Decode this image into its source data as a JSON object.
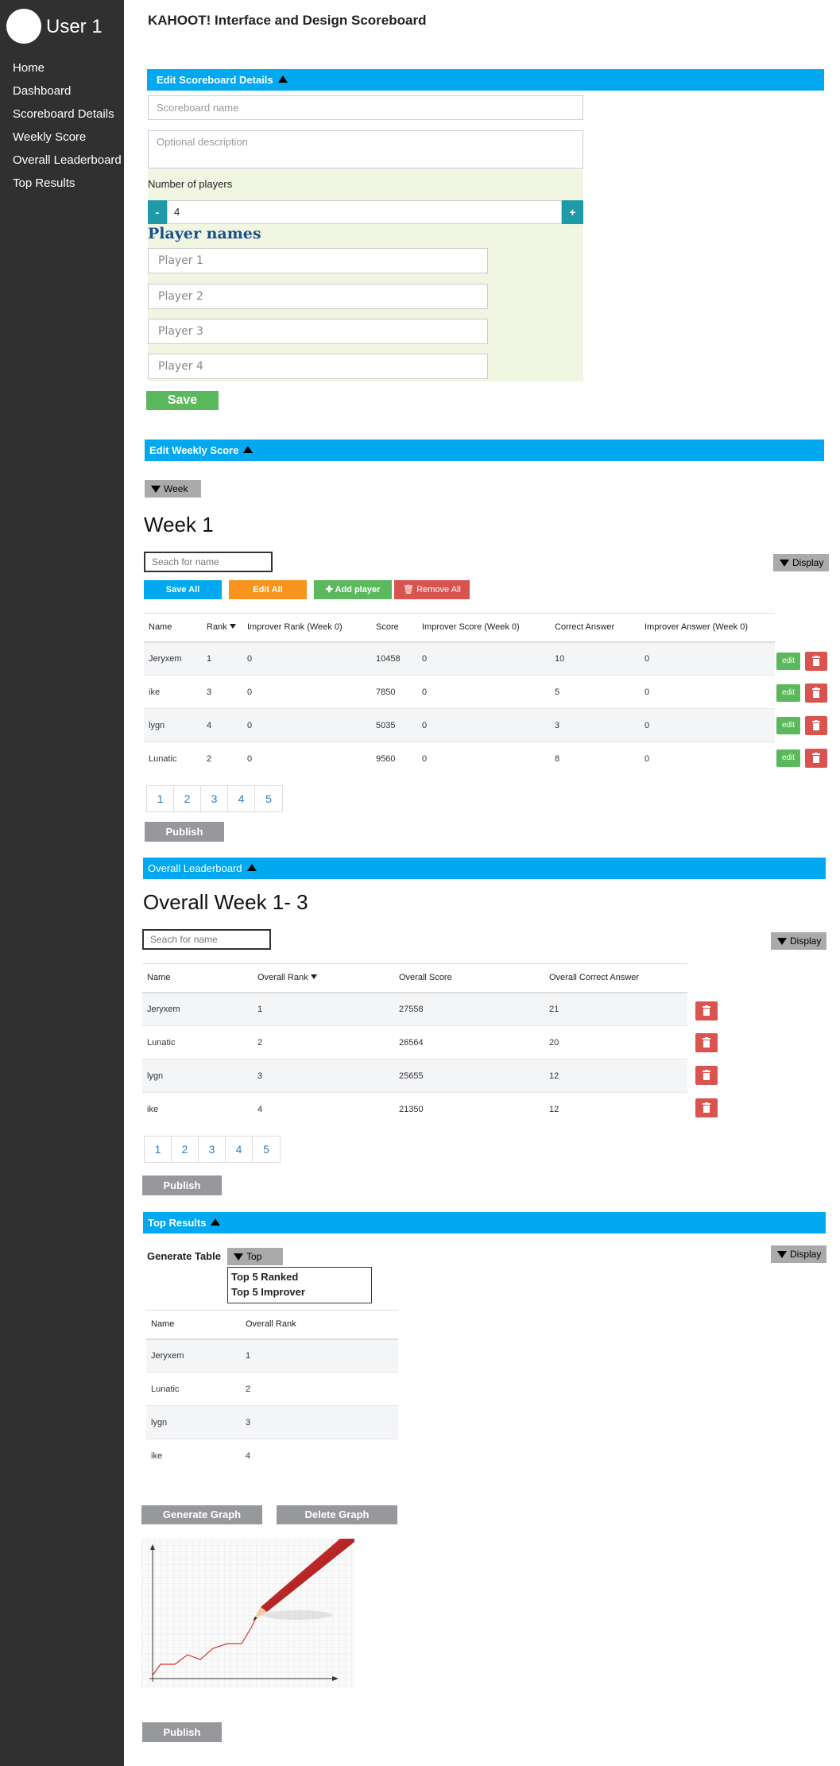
{
  "sidebar": {
    "username": "User 1",
    "nav": [
      "Home",
      "Dashboard",
      "Scoreboard Details",
      "Weekly Score",
      "Overall Leaderboard",
      "Top Results"
    ]
  },
  "page_title": "KAHOOT! Interface and Design Scoreboard",
  "details": {
    "header": "Edit Scoreboard Details",
    "name_placeholder": "Scoreboard name",
    "description_placeholder": "Optional description",
    "players_label": "Number of players",
    "minus": "-",
    "plus": "+",
    "player_count": "4",
    "player_names_heading": "Player names",
    "player_placeholders": [
      "Player 1",
      "Player 2",
      "Player 3",
      "Player 4"
    ],
    "save": "Save"
  },
  "weekly": {
    "header": "Edit Weekly Score",
    "week_dropdown": "Week",
    "heading": "Week 1",
    "search_placeholder": "Seach for name",
    "display": "Display",
    "save_all": "Save All",
    "edit_all": "Edit All",
    "add_player": "Add player",
    "remove_all": "Remove All",
    "columns": [
      "Name",
      "Rank",
      "Improver Rank (Week 0)",
      "Score",
      "Improver Score (Week 0)",
      "Correct Answer",
      "Improver Answer (Week 0)"
    ],
    "rows": [
      [
        "Jeryxem",
        "1",
        "0",
        "10458",
        "0",
        "10",
        "0"
      ],
      [
        "ike",
        "3",
        "0",
        "7850",
        "0",
        "5",
        "0"
      ],
      [
        "lygn",
        "4",
        "0",
        "5035",
        "0",
        "3",
        "0"
      ],
      [
        "Lunatic",
        "2",
        "0",
        "9560",
        "0",
        "8",
        "0"
      ]
    ],
    "edit_label": "edit",
    "pages": [
      "1",
      "2",
      "3",
      "4",
      "5"
    ],
    "publish": "Publish"
  },
  "overall": {
    "header": "Overall Leaderboard",
    "heading": "Overall Week 1- 3",
    "search_placeholder": "Seach for name",
    "display": "Display",
    "columns": [
      "Name",
      "Overall Rank",
      "Overall Score",
      "Overall Correct Answer"
    ],
    "rows": [
      [
        "Jeryxem",
        "1",
        "27558",
        "21"
      ],
      [
        "Lunatic",
        "2",
        "26564",
        "20"
      ],
      [
        "lygn",
        "3",
        "25655",
        "12"
      ],
      [
        "ike",
        "4",
        "21350",
        "12"
      ]
    ],
    "pages": [
      "1",
      "2",
      "3",
      "4",
      "5"
    ],
    "publish": "Publish"
  },
  "top": {
    "header": "Top Results",
    "generate_table": "Generate Table",
    "top_dropdown": "Top",
    "options": [
      "Top 5 Ranked",
      "Top 5 Improver"
    ],
    "display": "Display",
    "columns": [
      "Name",
      "Overall Rank"
    ],
    "rows": [
      [
        "Jeryxem",
        "1"
      ],
      [
        "Lunatic",
        "2"
      ],
      [
        "lygn",
        "3"
      ],
      [
        "ike",
        "4"
      ]
    ],
    "generate_graph": "Generate Graph",
    "delete_graph": "Delete Graph",
    "publish": "Publish"
  }
}
